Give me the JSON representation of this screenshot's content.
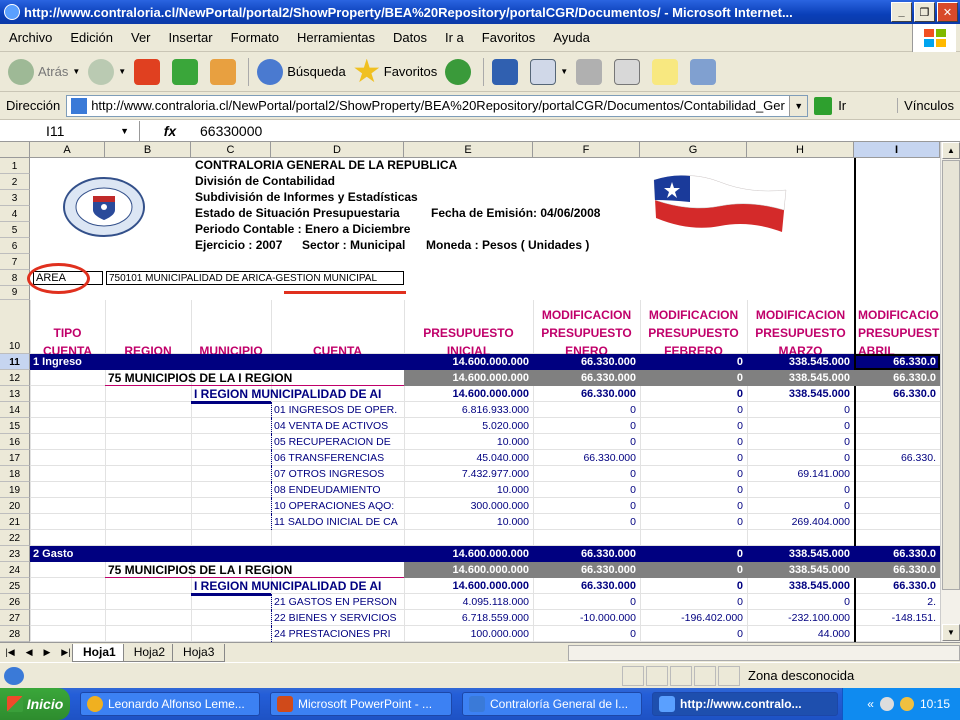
{
  "window": {
    "title": "http://www.contraloria.cl/NewPortal/portal2/ShowProperty/BEA%20Repository/portalCGR/Documentos/ - Microsoft Internet..."
  },
  "menu": [
    "Archivo",
    "Edición",
    "Ver",
    "Insertar",
    "Formato",
    "Herramientas",
    "Datos",
    "Ir a",
    "Favoritos",
    "Ayuda"
  ],
  "toolbar": {
    "back": "Atrás",
    "search": "Búsqueda",
    "favorites": "Favoritos"
  },
  "address": {
    "label": "Dirección",
    "url": "http://www.contraloria.cl/NewPortal/portal2/ShowProperty/BEA%20Repository/portalCGR/Documentos/Contabilidad_Ger",
    "go": "Ir",
    "links": "Vínculos"
  },
  "formula": {
    "cell": "I11",
    "fx": "fx",
    "value": "66330000"
  },
  "columns": [
    "A",
    "B",
    "C",
    "D",
    "E",
    "F",
    "G",
    "H",
    "I"
  ],
  "rows": [
    "1",
    "2",
    "3",
    "4",
    "5",
    "6",
    "7",
    "8",
    "9",
    "10",
    "11",
    "12",
    "13",
    "14",
    "15",
    "16",
    "17",
    "18",
    "19",
    "20",
    "21",
    "22",
    "23",
    "24",
    "25",
    "26",
    "27",
    "28"
  ],
  "header": {
    "line1": "CONTRALORIA GENERAL DE LA REPUBLICA",
    "line2": "División de Contabilidad",
    "line3": "Subdivisión de Informes y Estadísticas",
    "line4a": "Estado de Situación Presupuestaria",
    "line4b": "Fecha de Emisión:  04/06/2008",
    "line5": "Periodo Contable : Enero a Diciembre",
    "line6a": "Ejercicio : 2007",
    "line6b": "Sector : Municipal",
    "line6c": "Moneda : Pesos ( Unidades )",
    "seal_text": "CONTRALORIA GENERAL DE LA REPUBLICA 26.03.1927 CHILE"
  },
  "area": {
    "label": "AREA",
    "value": "750101 MUNICIPALIDAD DE ARICA-GESTION MUNICIPAL"
  },
  "colheads": {
    "a": "TIPO\nCUENTA",
    "b": "REGION",
    "c": "MUNICIPIO",
    "d": "CUENTA",
    "e": "PRESUPUESTO\nINICIAL",
    "f": "MODIFICACION\nPRESUPUESTO\nENERO",
    "g": "MODIFICACION\nPRESUPUESTO\nFEBRERO",
    "h": "MODIFICACION\nPRESUPUESTO\nMARZO",
    "i": "MODIFICACIO\nPRESUPUEST\nABRIL"
  },
  "data_rows": [
    {
      "row": "11",
      "style": "navy",
      "a": "1 Ingreso",
      "b": "",
      "c": "",
      "d": "",
      "e": "14.600.000.000",
      "f": "66.330.000",
      "g": "0",
      "h": "338.545.000",
      "i": "66.330.0"
    },
    {
      "row": "12",
      "style": "gray",
      "a": "",
      "b": "75 MUNICIPIOS DE LA I REGION",
      "c": "",
      "d": "",
      "e": "14.600.000.000",
      "f": "66.330.000",
      "g": "0",
      "h": "338.545.000",
      "i": "66.330.0"
    },
    {
      "row": "13",
      "style": "blue",
      "a": "",
      "b": "",
      "c": "I REGION MUNICIPALIDAD DE AI",
      "d": "",
      "e": "14.600.000.000",
      "f": "66.330.000",
      "g": "0",
      "h": "338.545.000",
      "i": "66.330.0"
    },
    {
      "row": "14",
      "style": "detail",
      "d": "01 INGRESOS DE OPER.",
      "e": "6.816.933.000",
      "f": "0",
      "g": "0",
      "h": "0",
      "i": ""
    },
    {
      "row": "15",
      "style": "detail",
      "d": "04 VENTA DE ACTIVOS",
      "e": "5.020.000",
      "f": "0",
      "g": "0",
      "h": "0",
      "i": ""
    },
    {
      "row": "16",
      "style": "detail",
      "d": "05 RECUPERACION DE",
      "e": "10.000",
      "f": "0",
      "g": "0",
      "h": "0",
      "i": ""
    },
    {
      "row": "17",
      "style": "detail",
      "d": "06 TRANSFERENCIAS",
      "e": "45.040.000",
      "f": "66.330.000",
      "g": "0",
      "h": "0",
      "i": "66.330."
    },
    {
      "row": "18",
      "style": "detail",
      "d": "07 OTROS INGRESOS",
      "e": "7.432.977.000",
      "f": "0",
      "g": "0",
      "h": "69.141.000",
      "i": ""
    },
    {
      "row": "19",
      "style": "detail",
      "d": "08 ENDEUDAMIENTO",
      "e": "10.000",
      "f": "0",
      "g": "0",
      "h": "0",
      "i": ""
    },
    {
      "row": "20",
      "style": "detail",
      "d": "10 OPERACIONES AQO:",
      "e": "300.000.000",
      "f": "0",
      "g": "0",
      "h": "0",
      "i": ""
    },
    {
      "row": "21",
      "style": "detail",
      "d": "11 SALDO INICIAL DE CA",
      "e": "10.000",
      "f": "0",
      "g": "0",
      "h": "269.404.000",
      "i": ""
    },
    {
      "row": "23",
      "style": "navy",
      "a": "2 Gasto",
      "b": "",
      "c": "",
      "d": "",
      "e": "14.600.000.000",
      "f": "66.330.000",
      "g": "0",
      "h": "338.545.000",
      "i": "66.330.0"
    },
    {
      "row": "24",
      "style": "gray",
      "a": "",
      "b": "75 MUNICIPIOS DE LA I REGION",
      "c": "",
      "d": "",
      "e": "14.600.000.000",
      "f": "66.330.000",
      "g": "0",
      "h": "338.545.000",
      "i": "66.330.0"
    },
    {
      "row": "25",
      "style": "blue",
      "a": "",
      "b": "",
      "c": "I REGION MUNICIPALIDAD DE AI",
      "d": "",
      "e": "14.600.000.000",
      "f": "66.330.000",
      "g": "0",
      "h": "338.545.000",
      "i": "66.330.0"
    },
    {
      "row": "26",
      "style": "detail",
      "d": "21 GASTOS EN PERSON",
      "e": "4.095.118.000",
      "f": "0",
      "g": "0",
      "h": "0",
      "i": "2."
    },
    {
      "row": "27",
      "style": "detail",
      "d": "22 BIENES Y SERVICIOS",
      "e": "6.718.559.000",
      "f": "-10.000.000",
      "g": "-196.402.000",
      "h": "-232.100.000",
      "i": "-148.151."
    },
    {
      "row": "28",
      "style": "detail",
      "d": "24 PRESTACIONES PRI",
      "e": "100.000.000",
      "f": "0",
      "g": "0",
      "h": "44.000",
      "i": ""
    }
  ],
  "tabs": [
    "Hoja1",
    "Hoja2",
    "Hoja3"
  ],
  "status": {
    "zone": "Zona desconocida"
  },
  "taskbar": {
    "start": "Inicio",
    "items": [
      "Leonardo Alfonso Leme...",
      "Microsoft PowerPoint - ...",
      "Contraloría General de l...",
      "http://www.contralo..."
    ],
    "chevron": "«",
    "clock": "10:15"
  },
  "colors": {
    "navy": "#000080",
    "gray": "#808080",
    "magenta": "#c0006a",
    "annotation": "#e0301e",
    "selected_col": "#c6d5f0"
  }
}
